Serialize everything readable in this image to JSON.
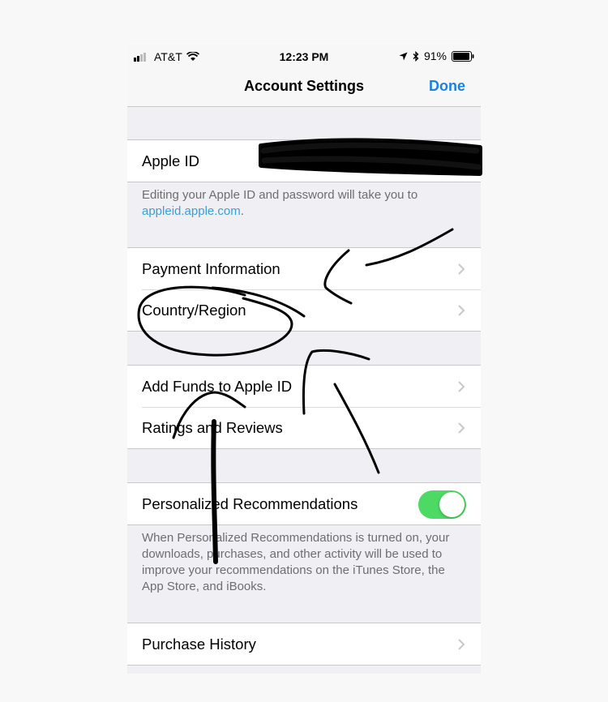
{
  "status_bar": {
    "carrier": "AT&T",
    "time": "12:23 PM",
    "battery": "91%",
    "icons": [
      "signal-icon",
      "wifi-icon",
      "location-icon",
      "bluetooth-icon",
      "battery-icon"
    ]
  },
  "nav": {
    "title": "Account Settings",
    "done_label": "Done"
  },
  "apple_id": {
    "label": "Apple ID",
    "note_text": "Editing your Apple ID and password will take you to",
    "note_link": "appleid.apple.com",
    "note_end": "."
  },
  "group2": {
    "payment": "Payment Information",
    "country": "Country/Region"
  },
  "group3": {
    "add_funds": "Add Funds to Apple ID",
    "ratings": "Ratings and Reviews"
  },
  "recommendations": {
    "label": "Personalized Recommendations",
    "enabled": true,
    "note": "When Personalized Recommendations is turned on, your downloads, purchases, and other activity will be used to improve your recommendations on the iTunes Store, the App Store, and iBooks."
  },
  "history": {
    "label": "Purchase History"
  },
  "colors": {
    "accent": "#1a82e0",
    "toggle_on": "#4cd964",
    "link": "#3b9fd6",
    "background": "#efeff4"
  }
}
